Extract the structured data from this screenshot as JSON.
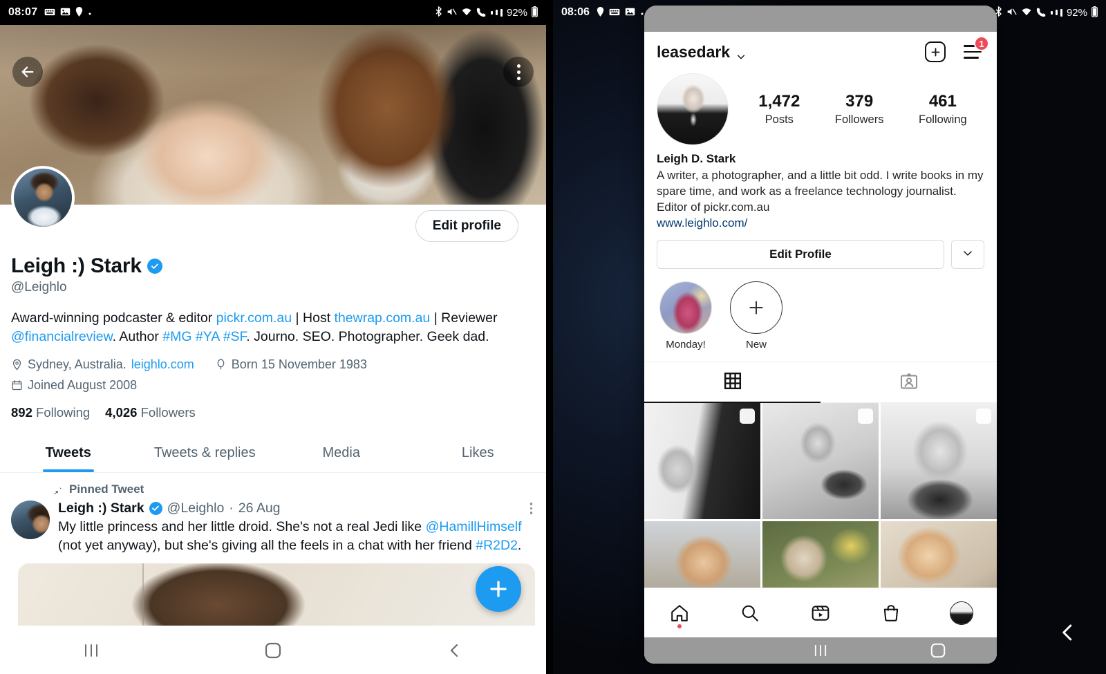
{
  "twitter": {
    "status_bar": {
      "time": "08:07",
      "battery": "92%"
    },
    "header": {
      "back_icon": "back-arrow-icon",
      "more_icon": "overflow-menu-icon"
    },
    "edit_profile_label": "Edit profile",
    "display_name": "Leigh :) Stark",
    "handle": "@Leighlo",
    "bio_parts": [
      {
        "text": "Award-winning podcaster & editor ",
        "link": false
      },
      {
        "text": "pickr.com.au",
        "link": true
      },
      {
        "text": " | Host ",
        "link": false
      },
      {
        "text": "thewrap.com.au",
        "link": true
      },
      {
        "text": " | Reviewer ",
        "link": false
      },
      {
        "text": "@financialreview",
        "link": true
      },
      {
        "text": ". Author ",
        "link": false
      },
      {
        "text": "#MG #YA #SF",
        "link": true
      },
      {
        "text": ". Journo. SEO. Photographer. Geek dad.",
        "link": false
      }
    ],
    "location": "Sydney, Australia.",
    "website": "leighlo.com",
    "born": "Born 15 November 1983",
    "joined": "Joined August 2008",
    "following_count": "892",
    "following_label": "Following",
    "followers_count": "4,026",
    "followers_label": "Followers",
    "tabs": [
      {
        "label": "Tweets",
        "active": true
      },
      {
        "label": "Tweets & replies",
        "active": false
      },
      {
        "label": "Media",
        "active": false
      },
      {
        "label": "Likes",
        "active": false
      }
    ],
    "pinned_label": "Pinned Tweet",
    "tweet": {
      "name": "Leigh :) Stark",
      "handle": "@Leighlo",
      "separator": "·",
      "date": "26 Aug",
      "text_parts": [
        {
          "text": "My little princess and her little droid. She's not a real Jedi like ",
          "link": false
        },
        {
          "text": "@HamillHimself",
          "link": true
        },
        {
          "text": " (not yet anyway), but she's giving all the feels in a chat with her friend ",
          "link": false
        },
        {
          "text": "#R2D2",
          "link": true
        },
        {
          "text": ".",
          "link": false
        }
      ]
    },
    "compose_icon": "plus-icon",
    "system_nav": [
      "recents-icon",
      "home-icon",
      "back-icon"
    ],
    "accent_color": "#1d9bf0"
  },
  "instagram": {
    "status_bar": {
      "time": "08:06",
      "battery": "92%"
    },
    "username": "leasedark",
    "chevron_icon": "chevron-down-icon",
    "add_icon": "plus-box-icon",
    "menu_icon": "hamburger-menu-icon",
    "menu_badge": "1",
    "stats": [
      {
        "num": "1,472",
        "label": "Posts"
      },
      {
        "num": "379",
        "label": "Followers"
      },
      {
        "num": "461",
        "label": "Following"
      }
    ],
    "real_name": "Leigh D. Stark",
    "bio": "A writer, a photographer, and a little bit odd. I write books in my spare time, and work as a freelance technology journalist. Editor of pickr.com.au",
    "bio_link": "www.leighlo.com/",
    "edit_profile_label": "Edit Profile",
    "dropdown_icon": "chevron-down-icon",
    "highlights": [
      {
        "label": "Monday!",
        "type": "story"
      },
      {
        "label": "New",
        "type": "add"
      }
    ],
    "content_tabs": [
      {
        "icon": "grid-icon",
        "active": true
      },
      {
        "icon": "tagged-person-icon",
        "active": false
      }
    ],
    "grid_posts": [
      {
        "id": "post-1",
        "style": "ph1",
        "multi": true
      },
      {
        "id": "post-2",
        "style": "ph2",
        "multi": true
      },
      {
        "id": "post-3",
        "style": "ph3",
        "multi": true
      },
      {
        "id": "post-4",
        "style": "ph4",
        "multi": false
      },
      {
        "id": "post-5",
        "style": "ph5",
        "multi": false
      },
      {
        "id": "post-6",
        "style": "ph6",
        "multi": false
      }
    ],
    "bottom_nav": [
      "home-icon",
      "search-icon",
      "reels-icon",
      "shop-icon",
      "profile-avatar-icon"
    ],
    "system_nav": [
      "recents-icon",
      "home-icon"
    ],
    "badge_color": "#ED4956",
    "link_color": "#00376b"
  },
  "right_back_icon": "back-chevron-icon"
}
